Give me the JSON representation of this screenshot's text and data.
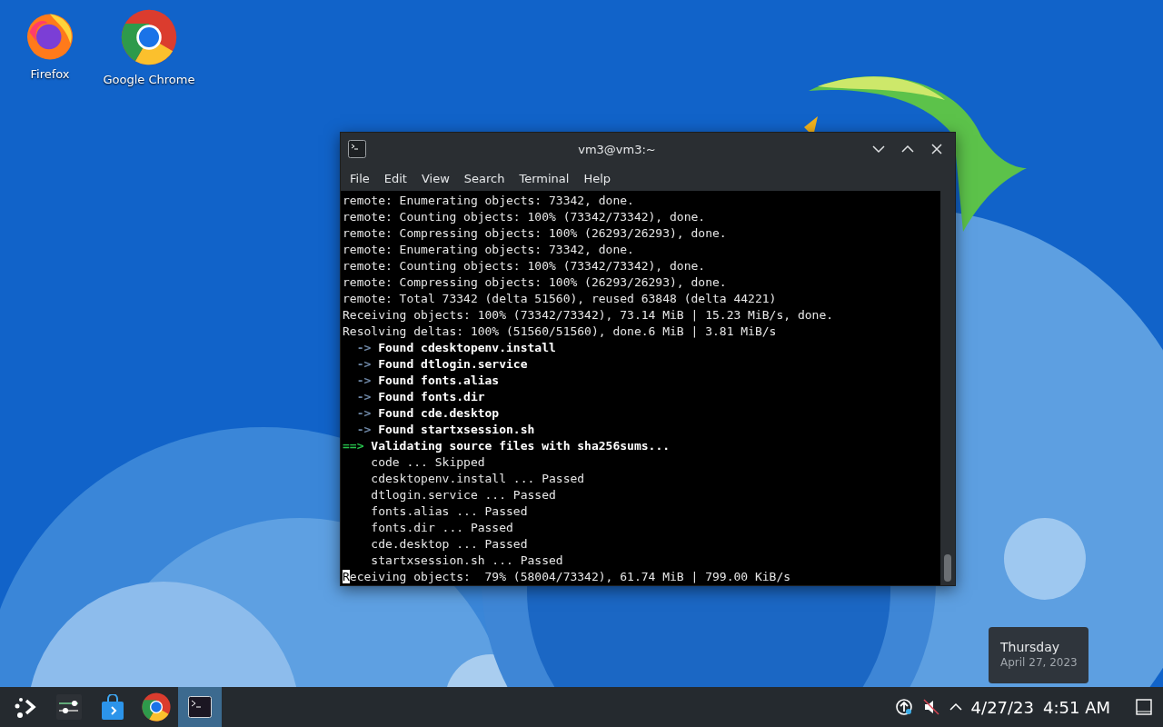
{
  "desktop_icons": [
    {
      "kind": "firefox",
      "label": "Firefox"
    },
    {
      "kind": "chrome",
      "label": "Google Chrome"
    }
  ],
  "window": {
    "title": "vm3@vm3:~",
    "menu": [
      "File",
      "Edit",
      "View",
      "Search",
      "Terminal",
      "Help"
    ],
    "lines": [
      {
        "kind": "plain",
        "text": "remote: Enumerating objects: 73342, done."
      },
      {
        "kind": "plain",
        "text": "remote: Counting objects: 100% (73342/73342), done."
      },
      {
        "kind": "plain",
        "text": "remote: Compressing objects: 100% (26293/26293), done."
      },
      {
        "kind": "plain",
        "text": "remote: Enumerating objects: 73342, done."
      },
      {
        "kind": "plain",
        "text": "remote: Counting objects: 100% (73342/73342), done."
      },
      {
        "kind": "plain",
        "text": "remote: Compressing objects: 100% (26293/26293), done."
      },
      {
        "kind": "plain",
        "text": "remote: Total 73342 (delta 51560), reused 63848 (delta 44221)"
      },
      {
        "kind": "plain",
        "text": "Receiving objects: 100% (73342/73342), 73.14 MiB | 15.23 MiB/s, done."
      },
      {
        "kind": "plain",
        "text": "Resolving deltas: 100% (51560/51560), done.6 MiB | 3.81 MiB/s"
      },
      {
        "kind": "arrow",
        "prefix": "->",
        "text": "Found cdesktopenv.install"
      },
      {
        "kind": "arrow",
        "prefix": "->",
        "text": "Found dtlogin.service"
      },
      {
        "kind": "arrow",
        "prefix": "->",
        "text": "Found fonts.alias"
      },
      {
        "kind": "arrow",
        "prefix": "->",
        "text": "Found fonts.dir"
      },
      {
        "kind": "arrow",
        "prefix": "->",
        "text": "Found cde.desktop"
      },
      {
        "kind": "arrow",
        "prefix": "->",
        "text": "Found startxsession.sh"
      },
      {
        "kind": "heading",
        "prefix": "==>",
        "text": "Validating source files with sha256sums..."
      },
      {
        "kind": "indented",
        "text": "code ... Skipped"
      },
      {
        "kind": "indented",
        "text": "cdesktopenv.install ... Passed"
      },
      {
        "kind": "indented",
        "text": "dtlogin.service ... Passed"
      },
      {
        "kind": "indented",
        "text": "fonts.alias ... Passed"
      },
      {
        "kind": "indented",
        "text": "fonts.dir ... Passed"
      },
      {
        "kind": "indented",
        "text": "cde.desktop ... Passed"
      },
      {
        "kind": "indented",
        "text": "startxsession.sh ... Passed"
      },
      {
        "kind": "cursor",
        "text": "Receiving objects:  79% (58004/73342), 61.74 MiB | 799.00 KiB/s"
      }
    ]
  },
  "taskbar": {
    "apps": [
      {
        "kind": "launcher",
        "selected": false
      },
      {
        "kind": "settings",
        "selected": false
      },
      {
        "kind": "store",
        "selected": false
      },
      {
        "kind": "chrome",
        "selected": false
      },
      {
        "kind": "terminal",
        "selected": true
      }
    ],
    "date": "4/27/23",
    "time": "4:51 AM"
  },
  "tooltip": {
    "day": "Thursday",
    "date": "April 27, 2023"
  }
}
